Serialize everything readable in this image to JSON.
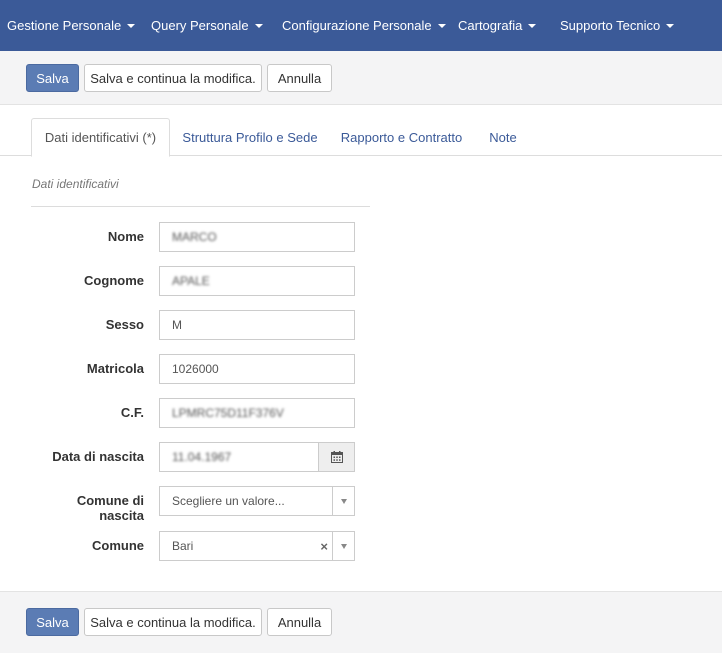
{
  "nav": {
    "items": [
      {
        "label": "Gestione Personale"
      },
      {
        "label": "Query Personale"
      },
      {
        "label": "Configurazione Personale"
      },
      {
        "label": "Cartografia"
      },
      {
        "label": "Supporto Tecnico"
      }
    ]
  },
  "actions": {
    "save": "Salva",
    "save_continue": "Salva e continua la modifica.",
    "cancel": "Annulla"
  },
  "tabs": [
    {
      "label": "Dati identificativi (*)"
    },
    {
      "label": "Struttura Profilo e Sede"
    },
    {
      "label": "Rapporto e Contratto"
    },
    {
      "label": "Note"
    }
  ],
  "section": {
    "title": "Dati identificativi"
  },
  "form": {
    "nome": {
      "label": "Nome",
      "value": "MARCO"
    },
    "cognome": {
      "label": "Cognome",
      "value": "APALE"
    },
    "sesso": {
      "label": "Sesso",
      "value": "M"
    },
    "matricola": {
      "label": "Matricola",
      "value": "1026000"
    },
    "cf": {
      "label": "C.F.",
      "value": "LPMRC75D11F376V"
    },
    "data_nascita": {
      "label": "Data di nascita",
      "value": "11.04.1967"
    },
    "comune_nascita": {
      "label": "Comune di nascita",
      "placeholder": "Scegliere un valore..."
    },
    "comune": {
      "label": "Comune",
      "value": "Bari"
    }
  },
  "colors": {
    "navbar": "#3b5a98",
    "primary": "#5b7cb4"
  }
}
